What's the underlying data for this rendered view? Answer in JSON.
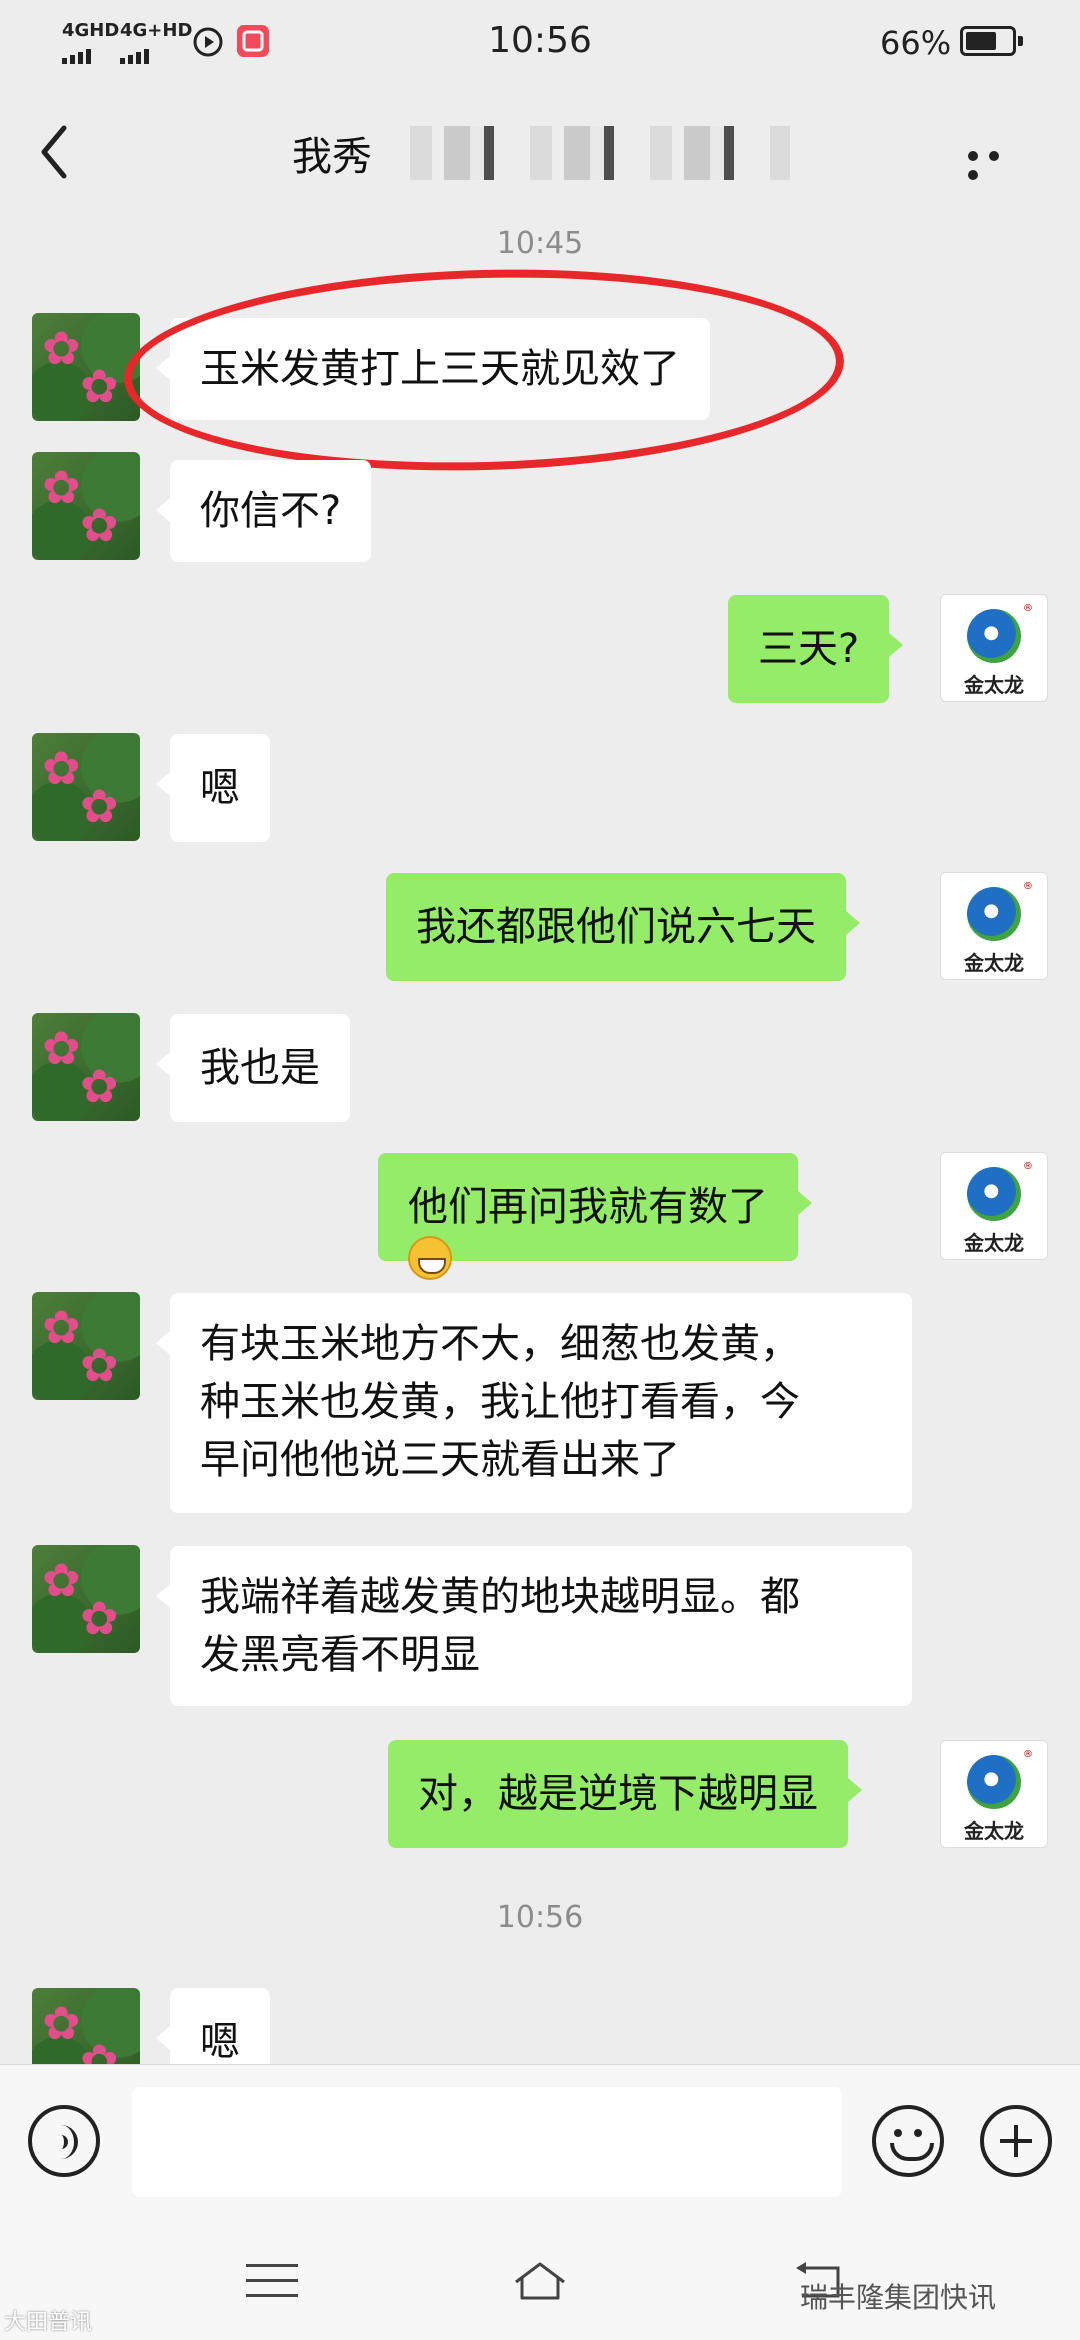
{
  "status_bar": {
    "network_1": "4GHD",
    "network_2": "4G+HD",
    "time": "10:56",
    "battery": "66%"
  },
  "header": {
    "title": "我秀"
  },
  "timestamps": [
    "10:45",
    "10:56"
  ],
  "messages": [
    {
      "side": "left",
      "lines": [
        "玉米发黄打上三天就见效了"
      ]
    },
    {
      "side": "left",
      "lines": [
        "你信不?"
      ]
    },
    {
      "side": "right",
      "lines": [
        "三天?"
      ]
    },
    {
      "side": "left",
      "lines": [
        "嗯"
      ]
    },
    {
      "side": "right",
      "lines": [
        "我还都跟他们说六七天"
      ]
    },
    {
      "side": "left",
      "lines": [
        "我也是"
      ]
    },
    {
      "side": "right",
      "lines": [
        "他们再问我就有数了"
      ],
      "emoji": "grin-emoji"
    },
    {
      "side": "left",
      "lines": [
        "有块玉米地方不大，细葱也发黄，",
        "种玉米也发黄，我让他打看看，今",
        "早问他他说三天就看出来了"
      ]
    },
    {
      "side": "left",
      "lines": [
        "我端祥着越发黄的地块越明显。都",
        "发黑亮看不明显"
      ]
    },
    {
      "side": "right",
      "lines": [
        "对，越是逆境下越明显"
      ]
    },
    {
      "side": "left",
      "lines": [
        "嗯"
      ]
    }
  ],
  "contact_avatar": {
    "icon": "lotus-avatar"
  },
  "self_avatar": {
    "brand": "金太龙",
    "reg": "®"
  },
  "annotation": {
    "color": "#e8272a"
  },
  "input": {
    "placeholder": ""
  },
  "watermarks": {
    "left": "大田普讯",
    "right": "瑞丰隆集团快讯"
  },
  "colors": {
    "background": "#ededed",
    "bubble_self": "#95ec69",
    "bubble_other": "#ffffff"
  }
}
